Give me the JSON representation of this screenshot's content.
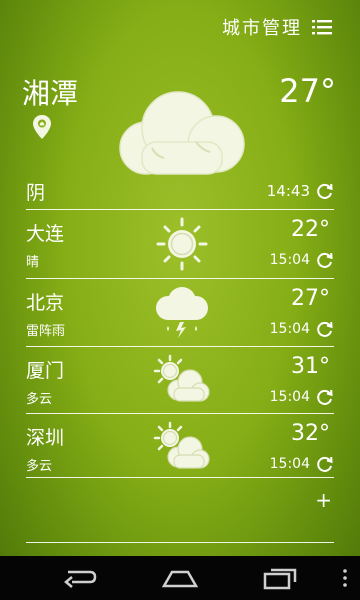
{
  "header": {
    "city_manage_label": "城市管理",
    "menu_icon": "list-menu-icon"
  },
  "current": {
    "city": "湘潭",
    "temperature": "27°",
    "condition": "阴",
    "update_time": "14:43",
    "icon": "cloud-icon"
  },
  "cities": [
    {
      "name": "大连",
      "condition": "晴",
      "temperature": "22°",
      "update_time": "15:04",
      "icon": "sun-icon"
    },
    {
      "name": "北京",
      "condition": "雷阵雨",
      "temperature": "27°",
      "update_time": "15:04",
      "icon": "thunderstorm-icon"
    },
    {
      "name": "厦门",
      "condition": "多云",
      "temperature": "31°",
      "update_time": "15:04",
      "icon": "partly-cloudy-icon"
    },
    {
      "name": "深圳",
      "condition": "多云",
      "temperature": "32°",
      "update_time": "15:04",
      "icon": "partly-cloudy-icon"
    }
  ],
  "add_button": "+",
  "colors": {
    "background_top": "#9cbf2a",
    "background_bottom": "#4d7408",
    "text": "#ffffff",
    "icon_fill": "#f3f6e2",
    "navbar": "#050505"
  }
}
